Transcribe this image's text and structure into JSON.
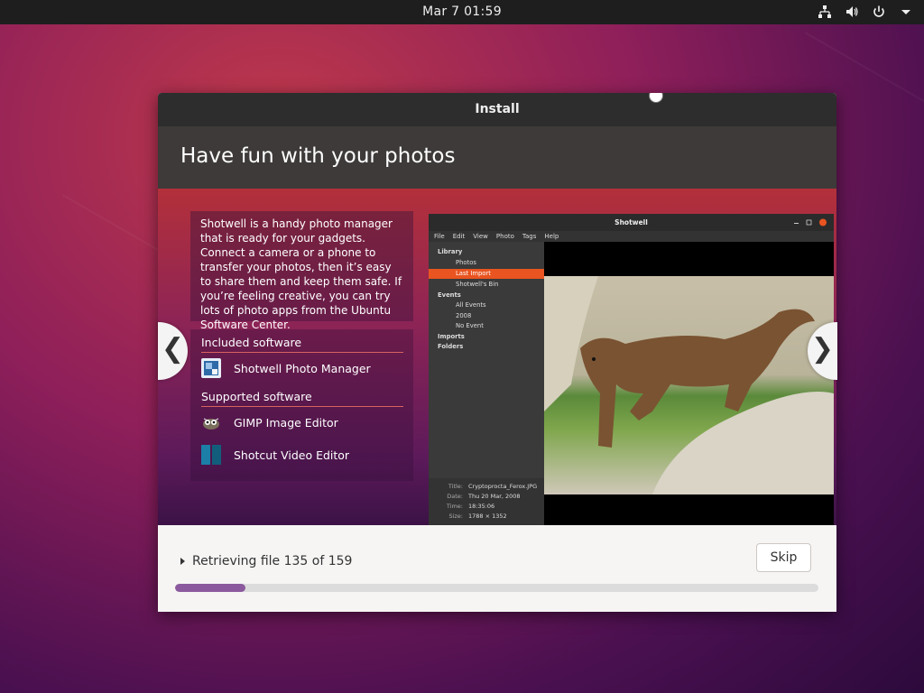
{
  "topbar": {
    "clock": "Mar 7  01:59",
    "tray_icons": [
      "network-icon",
      "volume-icon",
      "power-icon",
      "chevron-down-icon"
    ]
  },
  "window": {
    "title": "Install"
  },
  "slide": {
    "heading": "Have fun with your photos",
    "description": "Shotwell is a handy photo manager that is ready for your gadgets. Connect a camera or a phone to transfer your photos, then it’s easy to share them and keep them safe. If you’re feeling creative, you can try lots of photo apps from the Ubuntu Software Center.",
    "included_heading": "Included software",
    "included": [
      {
        "name": "Shotwell Photo Manager",
        "icon": "shotwell-icon"
      }
    ],
    "supported_heading": "Supported software",
    "supported": [
      {
        "name": "GIMP Image Editor",
        "icon": "gimp-icon"
      },
      {
        "name": "Shotcut Video Editor",
        "icon": "shotcut-icon"
      }
    ],
    "prev_arrow": "❮",
    "next_arrow": "❯"
  },
  "screenshot": {
    "title": "Shotwell",
    "menu": [
      "File",
      "Edit",
      "View",
      "Photo",
      "Tags",
      "Help"
    ],
    "tree": [
      {
        "label": "Library",
        "level": 0,
        "bold": true
      },
      {
        "label": "Photos",
        "level": 1
      },
      {
        "label": "Last Import",
        "level": 1,
        "selected": true
      },
      {
        "label": "Shotwell's Bin",
        "level": 1
      },
      {
        "label": "Events",
        "level": 0,
        "bold": true
      },
      {
        "label": "All Events",
        "level": 1
      },
      {
        "label": "2008",
        "level": 1
      },
      {
        "label": "No Event",
        "level": 1
      },
      {
        "label": "Imports",
        "level": 0,
        "bold": true
      },
      {
        "label": "Folders",
        "level": 0,
        "bold": true
      }
    ],
    "meta": [
      {
        "key": "Title:",
        "value": "Cryptoprocta_Ferox.JPG"
      },
      {
        "key": "Date:",
        "value": "Thu 20 Mar, 2008"
      },
      {
        "key": "Time:",
        "value": "18:35:06"
      },
      {
        "key": "Size:",
        "value": "1788 × 1352"
      }
    ]
  },
  "footer": {
    "status": "Retrieving file 135 of 159",
    "skip_label": "Skip",
    "progress_percent": 11
  }
}
